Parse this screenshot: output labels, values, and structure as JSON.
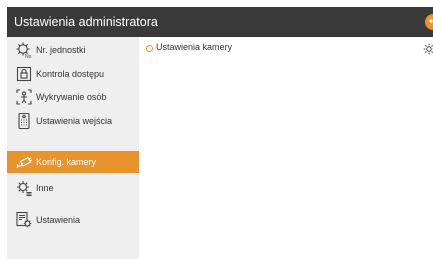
{
  "header": {
    "title": "Ustawienia administratora",
    "back_icon": "back-arrow-icon",
    "accent": "#e8932b"
  },
  "sidebar": {
    "items": [
      {
        "label": "Nr. jednostki",
        "icon": "unit-number-gear-icon",
        "active": false
      },
      {
        "label": "Kontrola dostępu",
        "icon": "access-control-icon",
        "active": false
      },
      {
        "label": "Wykrywanie osób",
        "icon": "person-detection-icon",
        "active": false
      },
      {
        "label": "Ustawienia wejścia",
        "icon": "entrance-panel-icon",
        "active": false
      },
      {
        "label": "Konfig. kamery",
        "icon": "camera-icon",
        "active": true
      },
      {
        "label": "Inne",
        "icon": "other-settings-icon",
        "active": false
      },
      {
        "label": "Ustawienia",
        "icon": "settings-doc-icon",
        "active": false
      }
    ]
  },
  "main": {
    "panel_title": "Ustawienia kamery",
    "gear_icon": "settings-gear-icon"
  }
}
